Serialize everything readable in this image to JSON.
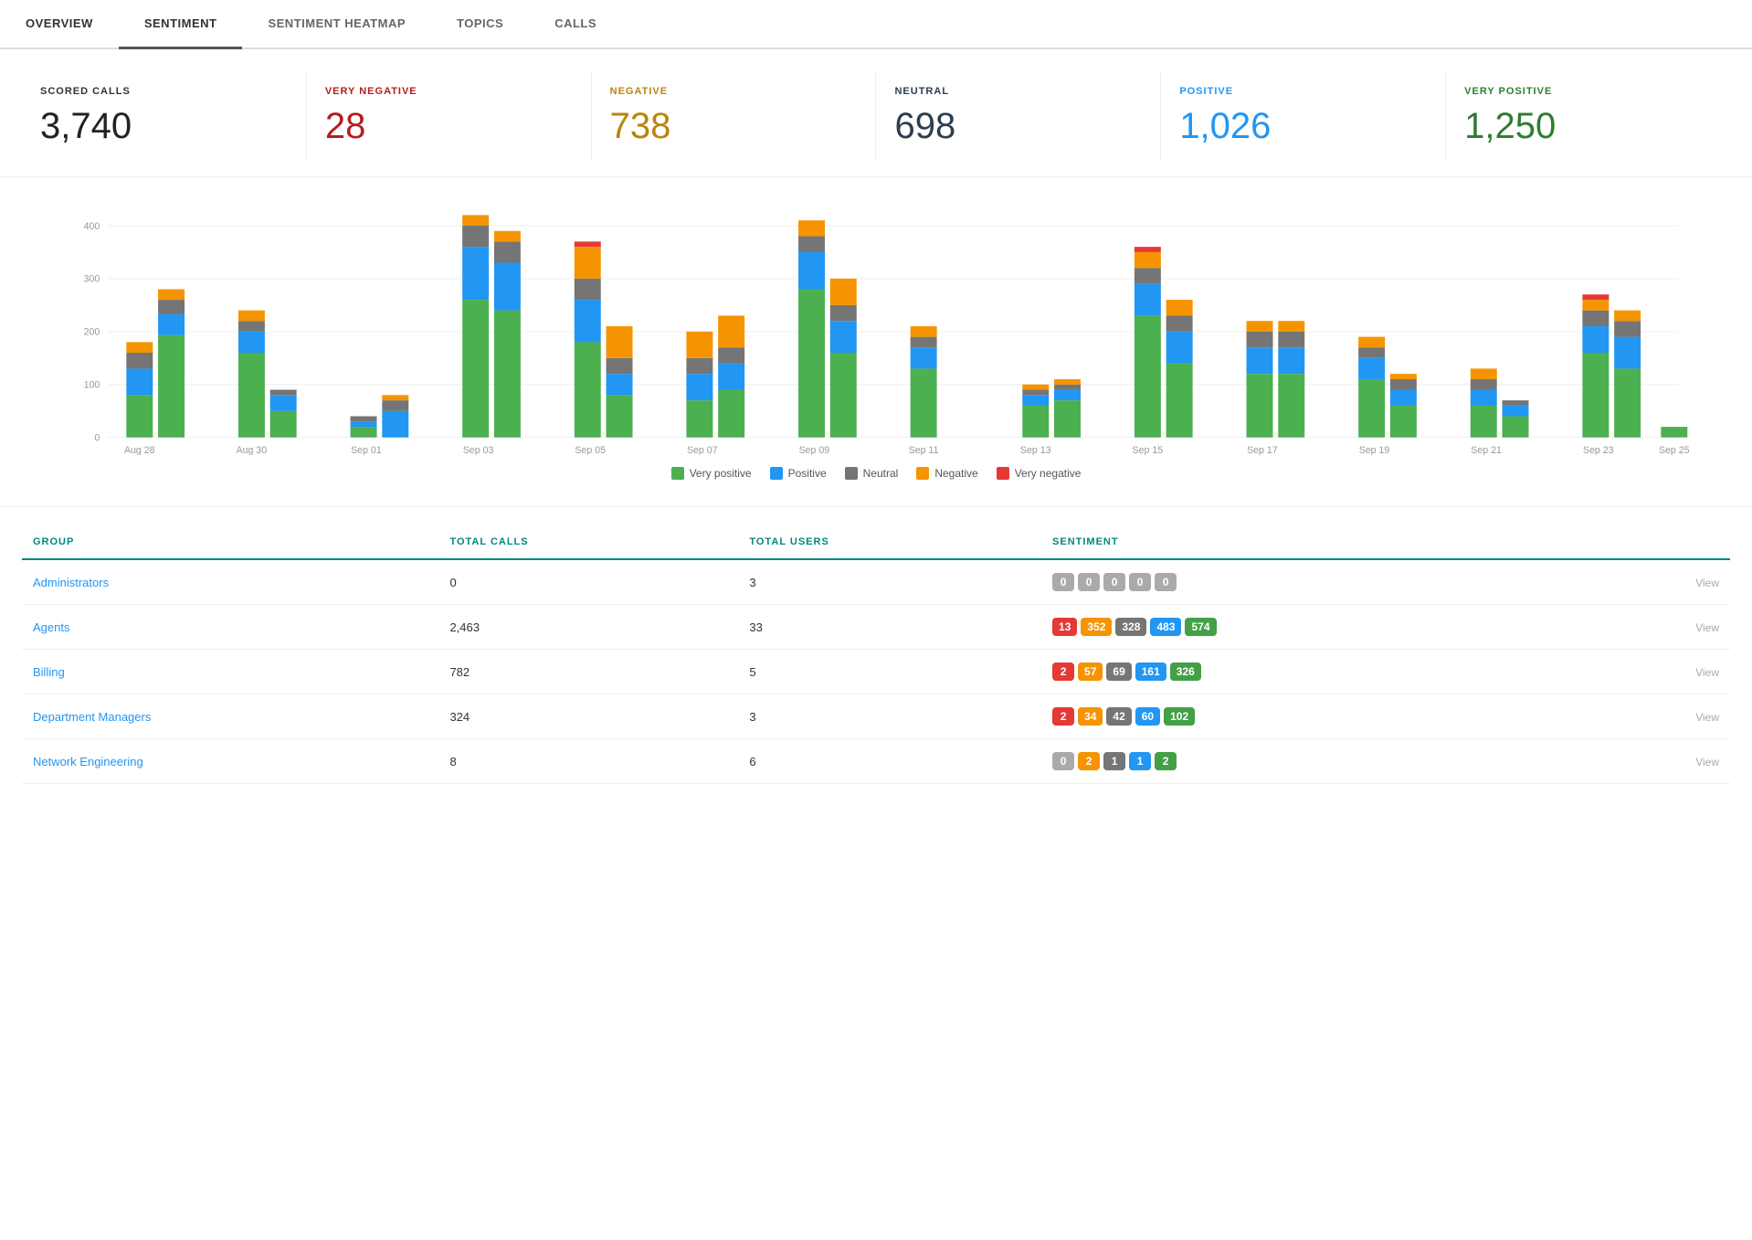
{
  "tabs": [
    {
      "label": "OVERVIEW",
      "active": false
    },
    {
      "label": "SENTIMENT",
      "active": true
    },
    {
      "label": "SENTIMENT HEATMAP",
      "active": false
    },
    {
      "label": "TOPICS",
      "active": false
    },
    {
      "label": "CALLS",
      "active": false
    }
  ],
  "metrics": [
    {
      "label": "SCORED CALLS",
      "value": "3,740",
      "colorClass": "color-dark",
      "labelClass": ""
    },
    {
      "label": "VERY NEGATIVE",
      "value": "28",
      "colorClass": "color-very-negative",
      "labelClass": "label-very-negative"
    },
    {
      "label": "NEGATIVE",
      "value": "738",
      "colorClass": "color-negative",
      "labelClass": "label-negative"
    },
    {
      "label": "NEUTRAL",
      "value": "698",
      "colorClass": "color-neutral",
      "labelClass": "label-neutral"
    },
    {
      "label": "POSITIVE",
      "value": "1,026",
      "colorClass": "color-positive",
      "labelClass": "label-positive"
    },
    {
      "label": "VERY POSITIVE",
      "value": "1,250",
      "colorClass": "color-very-positive",
      "labelClass": "label-very-positive"
    }
  ],
  "chart": {
    "yAxis": [
      0,
      100,
      200,
      300,
      400
    ],
    "xLabels": [
      "Aug 28",
      "Aug 30",
      "Sep 01",
      "Sep 03",
      "Sep 05",
      "Sep 07",
      "Sep 09",
      "Sep 11",
      "Sep 13",
      "Sep 15",
      "Sep 17",
      "Sep 19",
      "Sep 21",
      "Sep 23",
      "Sep 25"
    ],
    "legend": [
      {
        "label": "Very positive",
        "color": "#4caf50"
      },
      {
        "label": "Positive",
        "color": "#2196f3"
      },
      {
        "label": "Neutral",
        "color": "#757575"
      },
      {
        "label": "Negative",
        "color": "#f59400"
      },
      {
        "label": "Very negative",
        "color": "#e53935"
      }
    ]
  },
  "table": {
    "headers": [
      "GROUP",
      "TOTAL CALLS",
      "TOTAL USERS",
      "SENTIMENT",
      ""
    ],
    "rows": [
      {
        "group": "Administrators",
        "totalCalls": "0",
        "totalUsers": "3",
        "badges": [
          {
            "value": "0",
            "type": "zero"
          },
          {
            "value": "0",
            "type": "zero"
          },
          {
            "value": "0",
            "type": "zero"
          },
          {
            "value": "0",
            "type": "zero"
          },
          {
            "value": "0",
            "type": "zero"
          }
        ],
        "viewLabel": "View"
      },
      {
        "group": "Agents",
        "totalCalls": "2,463",
        "totalUsers": "33",
        "badges": [
          {
            "value": "13",
            "type": "vn"
          },
          {
            "value": "352",
            "type": "n"
          },
          {
            "value": "328",
            "type": "neu"
          },
          {
            "value": "483",
            "type": "p"
          },
          {
            "value": "574",
            "type": "vp"
          }
        ],
        "viewLabel": "View"
      },
      {
        "group": "Billing",
        "totalCalls": "782",
        "totalUsers": "5",
        "badges": [
          {
            "value": "2",
            "type": "vn"
          },
          {
            "value": "57",
            "type": "n"
          },
          {
            "value": "69",
            "type": "neu"
          },
          {
            "value": "161",
            "type": "p"
          },
          {
            "value": "326",
            "type": "vp"
          }
        ],
        "viewLabel": "View"
      },
      {
        "group": "Department Managers",
        "totalCalls": "324",
        "totalUsers": "3",
        "badges": [
          {
            "value": "2",
            "type": "vn"
          },
          {
            "value": "34",
            "type": "n"
          },
          {
            "value": "42",
            "type": "neu"
          },
          {
            "value": "60",
            "type": "p"
          },
          {
            "value": "102",
            "type": "vp"
          }
        ],
        "viewLabel": "View"
      },
      {
        "group": "Network Engineering",
        "totalCalls": "8",
        "totalUsers": "6",
        "badges": [
          {
            "value": "0",
            "type": "zero"
          },
          {
            "value": "2",
            "type": "n"
          },
          {
            "value": "1",
            "type": "neu"
          },
          {
            "value": "1",
            "type": "p"
          },
          {
            "value": "2",
            "type": "vp"
          }
        ],
        "viewLabel": "View"
      }
    ]
  },
  "colors": {
    "veryPositive": "#4caf50",
    "positive": "#2196f3",
    "neutral": "#757575",
    "negative": "#f59400",
    "veryNegative": "#e53935",
    "teal": "#00897b"
  }
}
